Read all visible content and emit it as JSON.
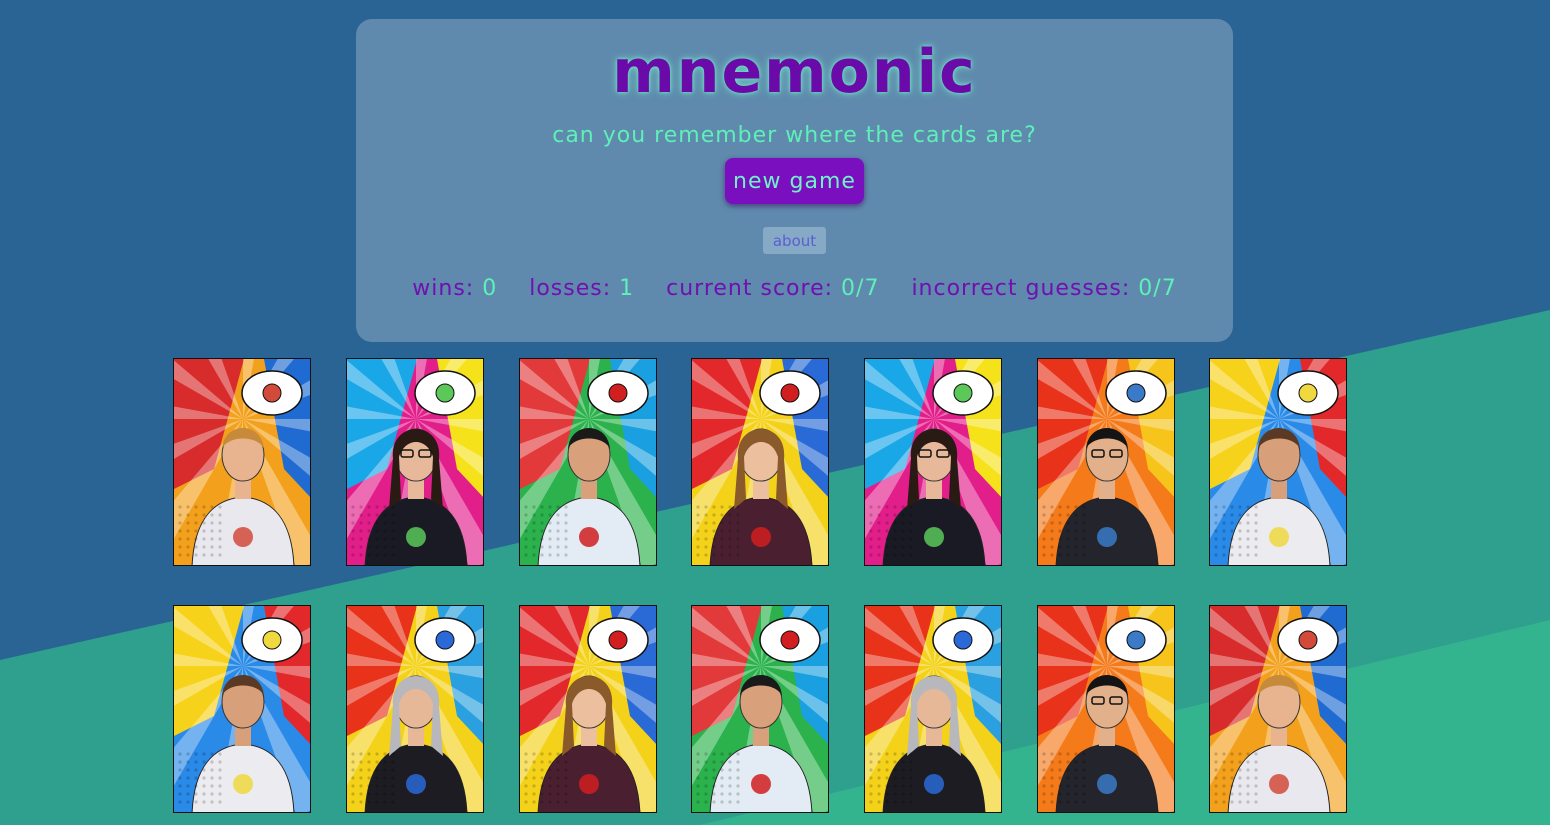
{
  "header": {
    "title": "mnemonic",
    "subtitle": "can you remember where the cards are?",
    "new_game_label": "new game",
    "about_label": "about"
  },
  "stats": {
    "wins_label": "wins:",
    "wins_value": "0",
    "losses_label": "losses:",
    "losses_value": "1",
    "score_label": "current score:",
    "score_value": "0/7",
    "incorrect_label": "incorrect guesses:",
    "incorrect_value": "0/7"
  },
  "colors": {
    "background": "#2a6494",
    "stripe": "#2f9f8e",
    "panel": "#5f8aad",
    "title": "#6a0aa8",
    "accent_green": "#5ef0b8",
    "button": "#7a0fbf"
  },
  "cards": [
    {
      "person": "man-blond",
      "icon": "ruby-badge-icon",
      "bg": [
        "#f3a11c",
        "#d82b2b",
        "#1f6bd1"
      ],
      "shirt": "#e8e8ee",
      "skin": "#e7b48f",
      "hair": "#c78a3a",
      "badge": "#d14a3a"
    },
    {
      "person": "woman-curly",
      "icon": "react-logo-icon",
      "bg": [
        "#e21e8a",
        "#1aa7e8",
        "#f6e21a"
      ],
      "shirt": "#1a1a24",
      "skin": "#e8b89a",
      "hair": "#2a1a14",
      "badge": "#5cc85a"
    },
    {
      "person": "man-dark",
      "icon": "rails-logo-icon",
      "bg": [
        "#2bb24c",
        "#e23a3a",
        "#1aa0e0"
      ],
      "shirt": "#e3ecf4",
      "skin": "#d9a07c",
      "hair": "#1a1a1a",
      "badge": "#d11f1f"
    },
    {
      "person": "woman-long",
      "icon": "rails-logo-icon",
      "bg": [
        "#f4d21a",
        "#e2282a",
        "#2a6ad6"
      ],
      "shirt": "#4a2030",
      "skin": "#ecbf9f",
      "hair": "#8a5a2a",
      "badge": "#d11f1f"
    },
    {
      "person": "woman-curly",
      "icon": "react-logo-icon",
      "bg": [
        "#e21e8a",
        "#1aa7e8",
        "#f6e21a"
      ],
      "shirt": "#1a1a24",
      "skin": "#e8b89a",
      "hair": "#2a1a14",
      "badge": "#5cc85a"
    },
    {
      "person": "man-glasses",
      "icon": "python-logo-icon",
      "bg": [
        "#f47a1a",
        "#e8321a",
        "#f6c41a"
      ],
      "shirt": "#24242c",
      "skin": "#e2b08a",
      "hair": "#141414",
      "badge": "#3a7ac8"
    },
    {
      "person": "man-shaved",
      "icon": "html-badge-icon",
      "bg": [
        "#2a8ae8",
        "#f6d21a",
        "#e2282a"
      ],
      "shirt": "#ececf0",
      "skin": "#d8a07a",
      "hair": "#5a3a24",
      "badge": "#f0d840"
    },
    {
      "person": "man-shaved",
      "icon": "html-badge-icon",
      "bg": [
        "#2a8ae8",
        "#f6d21a",
        "#e2282a"
      ],
      "shirt": "#ececf0",
      "skin": "#d8a07a",
      "hair": "#5a3a24",
      "badge": "#f0d840"
    },
    {
      "person": "woman-short",
      "icon": "css-logo-icon",
      "bg": [
        "#f4d21a",
        "#e8321a",
        "#2aa0e0"
      ],
      "shirt": "#1c1c22",
      "skin": "#e6b898",
      "hair": "#b8b8bc",
      "badge": "#2a6ad6"
    },
    {
      "person": "woman-long",
      "icon": "rails-logo-icon",
      "bg": [
        "#f4d21a",
        "#e2282a",
        "#2a6ad6"
      ],
      "shirt": "#4a2030",
      "skin": "#ecbf9f",
      "hair": "#8a5a2a",
      "badge": "#d11f1f"
    },
    {
      "person": "man-dark",
      "icon": "rails-logo-icon",
      "bg": [
        "#2bb24c",
        "#e23a3a",
        "#1aa0e0"
      ],
      "shirt": "#e3ecf4",
      "skin": "#d9a07c",
      "hair": "#1a1a1a",
      "badge": "#d11f1f"
    },
    {
      "person": "woman-short",
      "icon": "css-logo-icon",
      "bg": [
        "#f4d21a",
        "#e8321a",
        "#2aa0e0"
      ],
      "shirt": "#1c1c22",
      "skin": "#e6b898",
      "hair": "#b8b8bc",
      "badge": "#2a6ad6"
    },
    {
      "person": "man-glasses",
      "icon": "python-logo-icon",
      "bg": [
        "#f47a1a",
        "#e8321a",
        "#f6c41a"
      ],
      "shirt": "#24242c",
      "skin": "#e2b08a",
      "hair": "#141414",
      "badge": "#3a7ac8"
    },
    {
      "person": "man-blond",
      "icon": "ruby-badge-icon",
      "bg": [
        "#f3a11c",
        "#d82b2b",
        "#1f6bd1"
      ],
      "shirt": "#e8e8ee",
      "skin": "#e7b48f",
      "hair": "#c78a3a",
      "badge": "#d14a3a"
    }
  ]
}
